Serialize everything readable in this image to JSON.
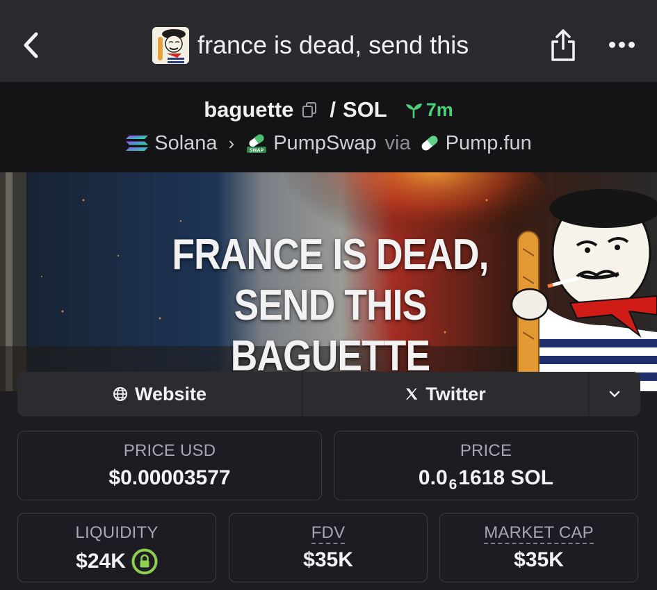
{
  "nav": {
    "title": "france is dead, send this",
    "icons": [
      "back-chevron-icon",
      "share-icon",
      "more-icon"
    ]
  },
  "pair": {
    "token": "baguette",
    "separator": "/",
    "quote": "SOL",
    "age": "7m",
    "chain": "Solana",
    "dex": "PumpSwap",
    "via": "via",
    "launchpad": "Pump.fun",
    "dex_badge": "SWAP"
  },
  "banner": {
    "line1": "FRANCE IS DEAD,",
    "line2": "SEND THIS BAGUETTE"
  },
  "links": {
    "website": "Website",
    "twitter": "Twitter"
  },
  "stats": {
    "price_usd": {
      "label": "PRICE USD",
      "value": "$0.00003577"
    },
    "price": {
      "label": "PRICE",
      "value_prefix": "0.0",
      "value_zeros": "6",
      "value_suffix": "1618 SOL"
    },
    "liquidity": {
      "label": "LIQUIDITY",
      "value": "$24K"
    },
    "fdv": {
      "label": "FDV",
      "value": "$35K"
    },
    "market_cap": {
      "label": "MARKET CAP",
      "value": "$35K"
    }
  },
  "colors": {
    "nav_bg": "#2a2a2e",
    "header_bg": "#141417",
    "page_bg": "#1c1c22",
    "accent_green": "#49d17a",
    "lock_green": "#8fd14f"
  }
}
